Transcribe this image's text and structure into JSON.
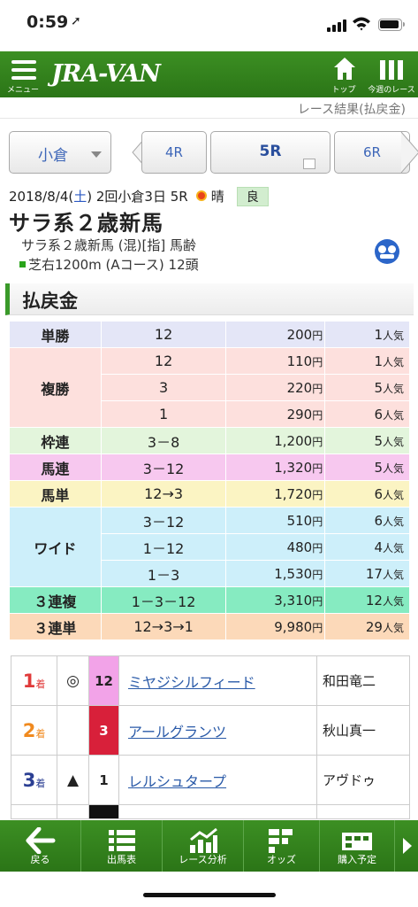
{
  "status_bar": {
    "time": "0:59"
  },
  "header": {
    "menu_label": "メニュー",
    "logo": "JRA-VAN",
    "top_label": "トップ",
    "week_label": "今週のレース"
  },
  "subheader": {
    "text": "レース結果(払戻金)"
  },
  "race_selector": {
    "venue": "小倉",
    "prev": "4R",
    "current": "5R",
    "next": "6R"
  },
  "race_info": {
    "date": "2018/8/4(",
    "day_of_week": "土",
    "meeting": ") 2回小倉3日 5R",
    "weather": "晴",
    "track_condition": "良",
    "race_name": "サラ系２歳新馬",
    "conditions": "サラ系２歳新馬 (混)[指] 馬齢",
    "course": "芝右1200m (Aコース) 12頭"
  },
  "section_title": "払戻金",
  "colors": {
    "tansho": "#e4e6f7",
    "fukusho": "#fde0dd",
    "wakuren": "#e3f5dc",
    "umaren": "#f7c8ef",
    "umatan": "#fbf4c3",
    "wide": "#cdeffa",
    "sanrenpuku": "#86ebc1",
    "sanrentan": "#fcd9b9",
    "brand_green": "#2f7d1b",
    "gold_medal": "#e03a3a",
    "second": "#f08a1f",
    "third": "#2b3f93"
  },
  "payouts": [
    {
      "bet": "単勝",
      "color": "tansho",
      "rows": [
        {
          "combo": "12",
          "amount": "200",
          "pop": "1"
        }
      ]
    },
    {
      "bet": "複勝",
      "color": "fukusho",
      "rows": [
        {
          "combo": "12",
          "amount": "110",
          "pop": "1"
        },
        {
          "combo": "3",
          "amount": "220",
          "pop": "5"
        },
        {
          "combo": "1",
          "amount": "290",
          "pop": "6"
        }
      ]
    },
    {
      "bet": "枠連",
      "color": "wakuren",
      "rows": [
        {
          "combo": "3－8",
          "amount": "1,200",
          "pop": "5"
        }
      ]
    },
    {
      "bet": "馬連",
      "color": "umaren",
      "rows": [
        {
          "combo": "3－12",
          "amount": "1,320",
          "pop": "5"
        }
      ]
    },
    {
      "bet": "馬単",
      "color": "umatan",
      "rows": [
        {
          "combo": "12→3",
          "amount": "1,720",
          "pop": "6"
        }
      ]
    },
    {
      "bet": "ワイド",
      "color": "wide",
      "rows": [
        {
          "combo": "3－12",
          "amount": "510",
          "pop": "6"
        },
        {
          "combo": "1－12",
          "amount": "480",
          "pop": "4"
        },
        {
          "combo": "1－3",
          "amount": "1,530",
          "pop": "17"
        }
      ]
    },
    {
      "bet": "３連複",
      "color": "sanrenpuku",
      "rows": [
        {
          "combo": "1－3－12",
          "amount": "3,310",
          "pop": "12"
        }
      ]
    },
    {
      "bet": "３連単",
      "color": "sanrentan",
      "rows": [
        {
          "combo": "12→3→1",
          "amount": "9,980",
          "pop": "29"
        }
      ]
    }
  ],
  "units": {
    "yen": "円",
    "popularity": "人気"
  },
  "finish_units": {
    "place": "着"
  },
  "finishers": [
    {
      "place": "1",
      "mark": "◎",
      "number": "12",
      "horse": "ミヤジシルフィード",
      "jockey": "和田竜二",
      "place_color": "#e03a3a",
      "num_bg": "#f2a3e8",
      "num_fg": "#222"
    },
    {
      "place": "2",
      "mark": "",
      "number": "3",
      "horse": "アールグランツ",
      "jockey": "秋山真一",
      "place_color": "#f08a1f",
      "num_bg": "#d8203a",
      "num_fg": "#fff"
    },
    {
      "place": "3",
      "mark": "▲",
      "number": "1",
      "horse": "レルシュタープ",
      "jockey": "アヴドゥ",
      "place_color": "#2b3f93",
      "num_bg": "#ffffff",
      "num_fg": "#222"
    }
  ],
  "bottom_nav": {
    "back": "戻る",
    "entries": "出馬表",
    "analysis": "レース分析",
    "odds": "オッズ",
    "purchase": "購入予定"
  }
}
